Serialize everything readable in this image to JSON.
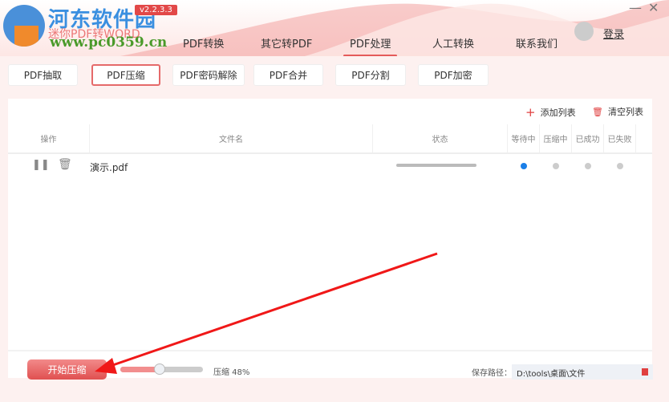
{
  "app": {
    "site_name": "河东软件园",
    "subtitle": "迷你PDF转WORD",
    "url": "www.pc0359.cn",
    "version": "v2.2.3.3"
  },
  "nav": [
    {
      "label": "PDF转换"
    },
    {
      "label": "其它转PDF"
    },
    {
      "label": "PDF处理",
      "active": true
    },
    {
      "label": "人工转换"
    },
    {
      "label": "联系我们"
    }
  ],
  "login": "登录",
  "window": {
    "minimize": "—",
    "close": "✕"
  },
  "toolbar": [
    {
      "label": "PDF抽取"
    },
    {
      "label": "PDF压缩",
      "active": true
    },
    {
      "label": "PDF密码解除"
    },
    {
      "label": "PDF合并"
    },
    {
      "label": "PDF分割"
    },
    {
      "label": "PDF加密"
    }
  ],
  "actions": {
    "add": "添加列表",
    "clear": "清空列表"
  },
  "columns": [
    "操作",
    "文件名",
    "状态",
    "等待中",
    "压缩中",
    "已成功",
    "已失败"
  ],
  "files": [
    {
      "name": "演示.pdf",
      "progress": 0,
      "state": "等待中"
    }
  ],
  "bottom": {
    "start": "开始压缩",
    "compress_label": "压缩 48%",
    "compress_value": 48,
    "save_label": "保存路径：",
    "save_path": "D:\\tools\\桌面\\文件"
  },
  "colors": {
    "accent": "#e45a5a",
    "waiting": "#1a7fe8"
  }
}
